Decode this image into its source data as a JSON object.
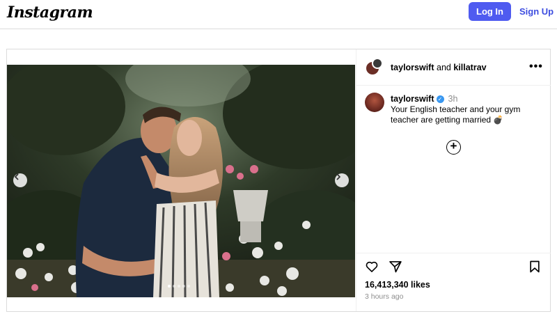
{
  "header": {
    "logo": "Instagram",
    "login_label": "Log In",
    "signup_label": "Sign Up",
    "accent_color": "#4f5bf0"
  },
  "post": {
    "header": {
      "user1": "taylorswift",
      "conjunction": "and",
      "user2": "killatrav",
      "more_icon": "more-horizontal-icon"
    },
    "caption": {
      "username": "taylorswift",
      "verified": true,
      "time": "3h",
      "text": "Your English teacher and your gym teacher are getting married 💣"
    },
    "media": {
      "carousel_count": 5,
      "active_index": 1,
      "prev_icon": "chevron-left-icon",
      "next_icon": "chevron-right-icon"
    },
    "actions": {
      "like_icon": "heart-icon",
      "share_icon": "paper-plane-icon",
      "save_icon": "bookmark-icon",
      "likes": "16,413,340 likes",
      "time_ago": "3 hours ago"
    }
  }
}
